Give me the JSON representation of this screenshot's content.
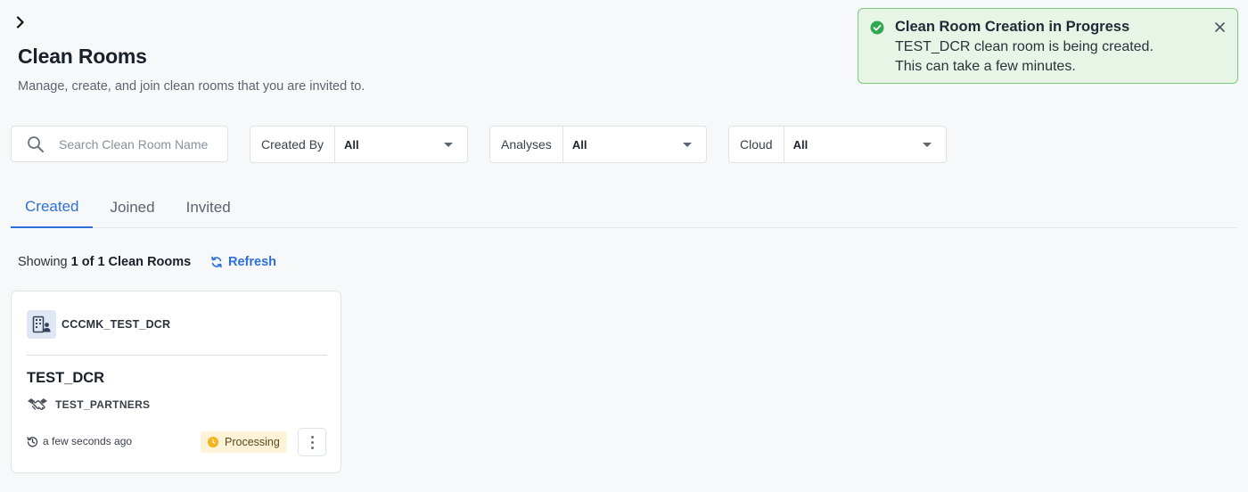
{
  "header": {
    "title": "Clean Rooms",
    "subtitle": "Manage, create, and join clean rooms that you are invited to."
  },
  "search": {
    "placeholder": "Search Clean Room Name",
    "value": ""
  },
  "filters": [
    {
      "label": "Created By",
      "value": "All"
    },
    {
      "label": "Analyses",
      "value": "All"
    },
    {
      "label": "Cloud",
      "value": "All"
    }
  ],
  "tabs": [
    {
      "label": "Created",
      "active": true
    },
    {
      "label": "Joined",
      "active": false
    },
    {
      "label": "Invited",
      "active": false
    }
  ],
  "results": {
    "showing_prefix": "Showing",
    "count_text": "1 of 1 Clean Rooms",
    "refresh_label": "Refresh"
  },
  "cards": [
    {
      "org": "CCCMK_TEST_DCR",
      "name": "TEST_DCR",
      "partner": "TEST_PARTNERS",
      "time": "a few seconds ago",
      "status": "Processing"
    }
  ],
  "toast": {
    "title": "Clean Room Creation in Progress",
    "line1": "TEST_DCR clean room is being created.",
    "line2": "This can take a few minutes."
  },
  "colors": {
    "accent": "#2e6fd8",
    "success": "#2fa84f",
    "toast_bg": "#e6f5e6",
    "processing_bg": "#fdf3d8",
    "processing_dot": "#f2b51c"
  },
  "icons": {
    "expand": "chevron-right-icon",
    "search": "search-icon",
    "refresh": "refresh-icon",
    "org": "building-user-icon",
    "partner": "handshake-icon",
    "time": "history-icon",
    "status": "clock-icon",
    "menu": "kebab-menu-icon",
    "toast_status": "check-circle-icon",
    "toast_close": "close-icon"
  }
}
